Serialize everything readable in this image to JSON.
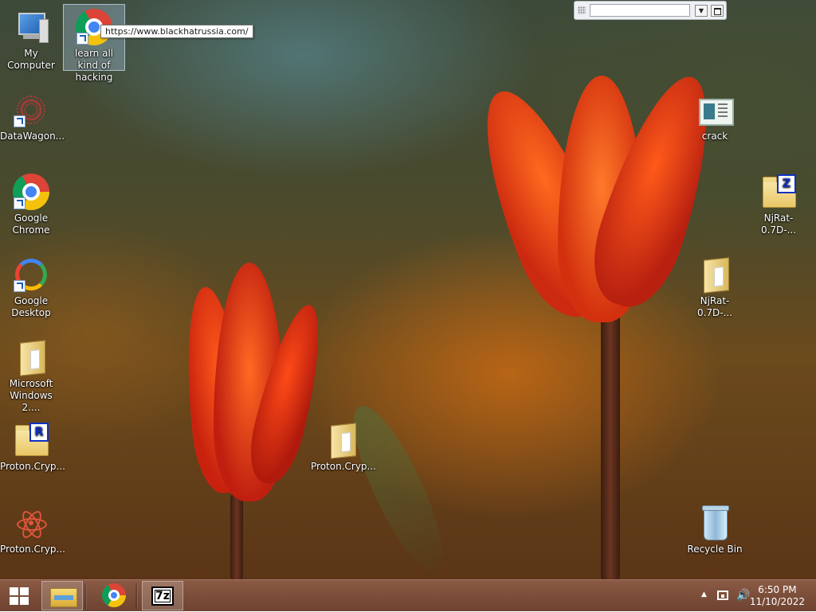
{
  "desktop": {
    "icons": [
      {
        "label": "My Computer",
        "icon": "computer-icon"
      },
      {
        "label": "learn all kind of hacking",
        "icon": "chrome-shortcut-icon"
      },
      {
        "label": "DataWagon...",
        "icon": "datawagon-shortcut-icon"
      },
      {
        "label": "Google Chrome",
        "icon": "chrome-shortcut-icon"
      },
      {
        "label": "Google Desktop",
        "icon": "google-desktop-shortcut-icon"
      },
      {
        "label": "Microsoft Windows 2....",
        "icon": "folder-icon"
      },
      {
        "label": "Proton.Cryp...",
        "icon": "rar-archive-icon"
      },
      {
        "label": "Proton.Cryp...",
        "icon": "atom-app-icon"
      },
      {
        "label": "Proton.Cryp...",
        "icon": "folder-icon"
      },
      {
        "label": "crack",
        "icon": "application-window-icon"
      },
      {
        "label": "NjRat-0.7D-...",
        "icon": "zip-archive-icon"
      },
      {
        "label": "NjRat-0.7D-...",
        "icon": "folder-icon"
      },
      {
        "label": "Recycle Bin",
        "icon": "recycle-bin-icon"
      }
    ],
    "tooltip": "https://www.blackhatrussia.com/"
  },
  "address_toolbar": {
    "value": "",
    "placeholder": ""
  },
  "taskbar": {
    "start_icon": "windows-logo-icon",
    "pinned": [
      "file-explorer-icon",
      "chrome-icon",
      "7zip-icon"
    ],
    "seven_zip_label": "7z"
  },
  "tray": {
    "time": "6:50 PM",
    "date": "11/10/2022"
  }
}
